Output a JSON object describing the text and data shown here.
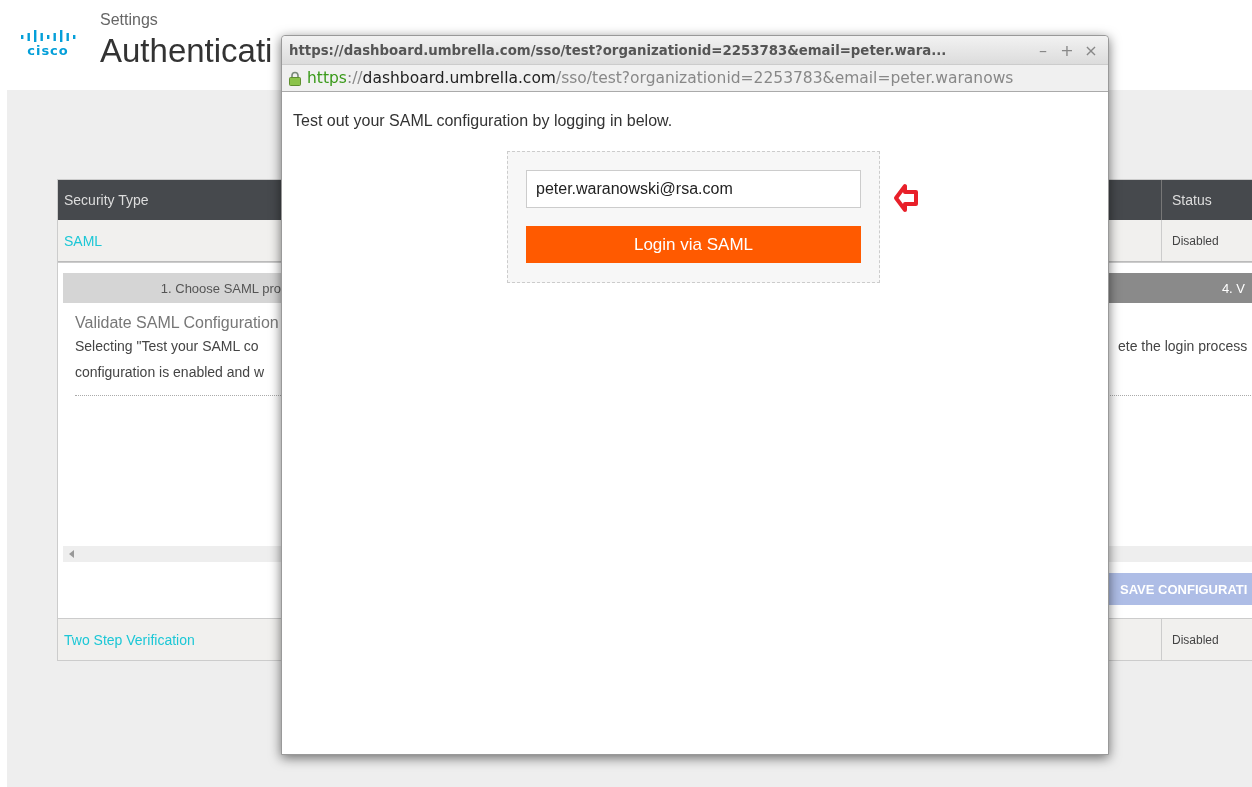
{
  "header": {
    "logo": "cisco",
    "breadcrumb": "Settings",
    "title": "Authenticati"
  },
  "table": {
    "columns": [
      {
        "label": "Security Type"
      },
      {
        "label": "Status"
      }
    ],
    "rows": [
      {
        "type": "SAML",
        "status": "Disabled",
        "expanded": true,
        "panel": {
          "steps": [
            {
              "label": "1. Choose SAML pro",
              "selected": false
            },
            {
              "label": "4. V",
              "selected": true
            }
          ],
          "heading": "Validate SAML Configuration",
          "left_lines": [
            "Selecting \"Test your SAML co",
            "configuration is enabled and w"
          ],
          "right_line": "ete the login process",
          "save_button": {
            "label": "SAVE CONFIGURATI",
            "disabled": true
          }
        }
      },
      {
        "type": "Two Step Verification",
        "status": "Disabled",
        "expanded": false
      }
    ]
  },
  "popup": {
    "title": "https://dashboard.umbrella.com/sso/test?organizationid=2253783&email=peter.wara...",
    "controls": [
      "–",
      "+",
      "×"
    ],
    "address": {
      "scheme": "https",
      "separator": "://",
      "host": "dashboard.umbrella.com",
      "path": "/sso/test?organizationid=2253783&email=peter.waranows"
    },
    "instruction": "Test out your SAML configuration by logging in below.",
    "email": {
      "value": "peter.waranowski@rsa.com"
    },
    "login_button": "Login via SAML"
  }
}
